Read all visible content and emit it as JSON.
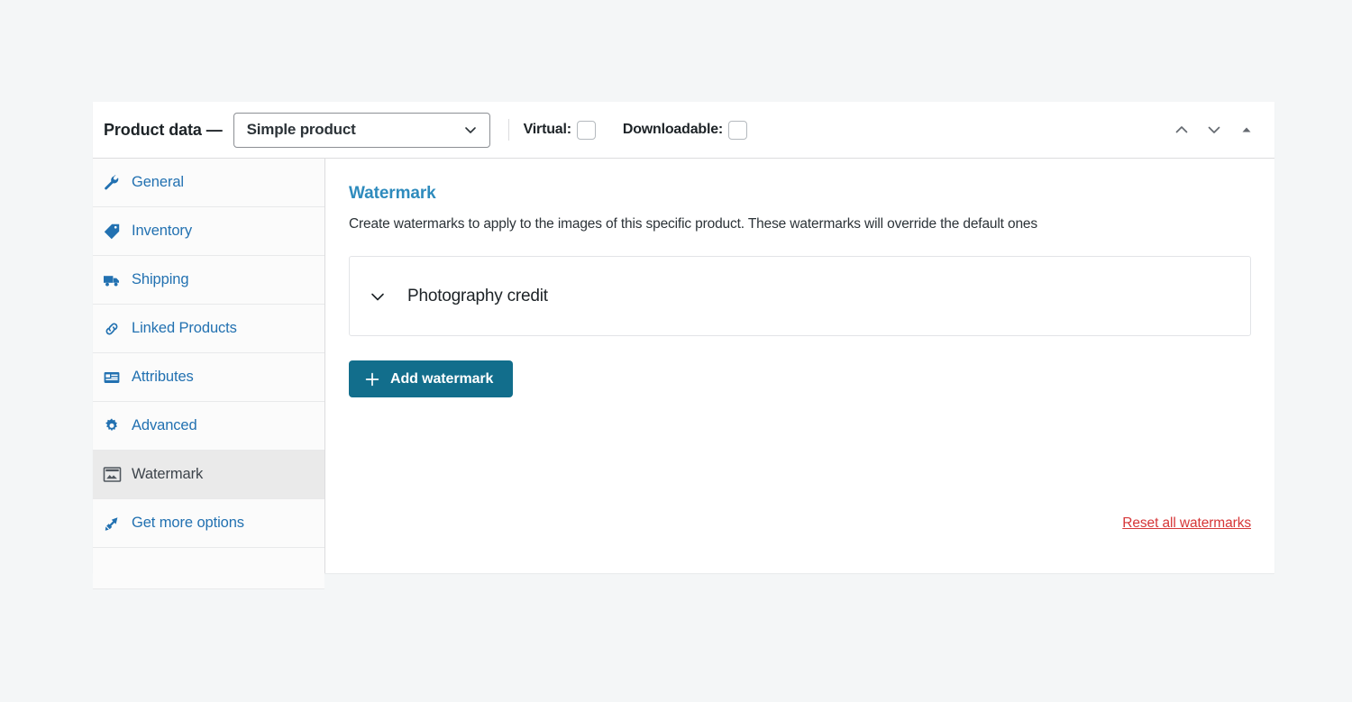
{
  "header": {
    "title": "Product data —",
    "product_type": {
      "value": "Simple product",
      "icon": "chevron-down-icon"
    },
    "virtual": {
      "label": "Virtual:",
      "checked": false
    },
    "downloadable": {
      "label": "Downloadable:",
      "checked": false
    },
    "controls": [
      {
        "name": "move-up-button",
        "icon": "chevron-up-icon"
      },
      {
        "name": "move-down-button",
        "icon": "chevron-down-icon"
      },
      {
        "name": "toggle-panel-button",
        "icon": "triangle-up-icon"
      }
    ]
  },
  "sidebar": {
    "items": [
      {
        "label": "General",
        "icon": "wrench-icon",
        "active": false
      },
      {
        "label": "Inventory",
        "icon": "tag-icon",
        "active": false
      },
      {
        "label": "Shipping",
        "icon": "truck-icon",
        "active": false
      },
      {
        "label": "Linked Products",
        "icon": "link-icon",
        "active": false
      },
      {
        "label": "Attributes",
        "icon": "list-icon",
        "active": false
      },
      {
        "label": "Advanced",
        "icon": "gear-icon",
        "active": false
      },
      {
        "label": "Watermark",
        "icon": "image-icon",
        "active": true
      },
      {
        "label": "Get more options",
        "icon": "plugin-icon",
        "active": false
      }
    ]
  },
  "content": {
    "title": "Watermark",
    "description": "Create watermarks to apply to the images of this specific product. These watermarks will override the default ones",
    "accordion": {
      "title": "Photography credit",
      "icon": "chevron-down-icon",
      "expanded": false
    },
    "add_button": {
      "label": "Add watermark",
      "icon": "plus-icon"
    },
    "reset_link": {
      "label": "Reset all watermarks"
    }
  },
  "colors": {
    "accent_blue": "#2271b1",
    "title_blue": "#2e8bbd",
    "button_teal": "#126e8c",
    "danger_red": "#d63638",
    "active_row": "#eaeaea"
  }
}
